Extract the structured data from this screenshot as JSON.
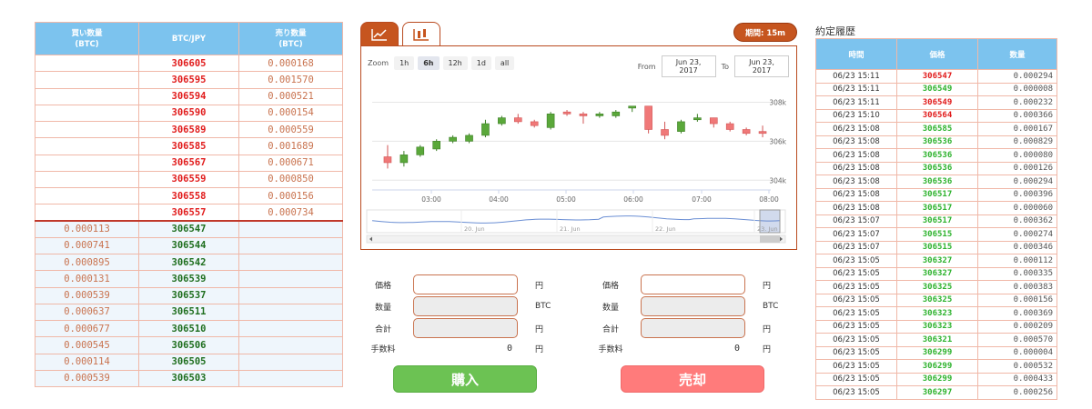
{
  "orderbook": {
    "headers": {
      "buy": "買い数量\n(BTC)",
      "price": "BTC/JPY",
      "sell": "売り数量\n(BTC)"
    },
    "asks": [
      {
        "price": "306605",
        "qty": "0.000168"
      },
      {
        "price": "306595",
        "qty": "0.001570"
      },
      {
        "price": "306594",
        "qty": "0.000521"
      },
      {
        "price": "306590",
        "qty": "0.000154"
      },
      {
        "price": "306589",
        "qty": "0.000559"
      },
      {
        "price": "306585",
        "qty": "0.001689"
      },
      {
        "price": "306567",
        "qty": "0.000671"
      },
      {
        "price": "306559",
        "qty": "0.000850"
      },
      {
        "price": "306558",
        "qty": "0.000156"
      },
      {
        "price": "306557",
        "qty": "0.000734"
      }
    ],
    "bids": [
      {
        "price": "306547",
        "qty": "0.000113"
      },
      {
        "price": "306544",
        "qty": "0.000741"
      },
      {
        "price": "306542",
        "qty": "0.000895"
      },
      {
        "price": "306539",
        "qty": "0.000131"
      },
      {
        "price": "306537",
        "qty": "0.000539"
      },
      {
        "price": "306511",
        "qty": "0.000637"
      },
      {
        "price": "306510",
        "qty": "0.000677"
      },
      {
        "price": "306506",
        "qty": "0.000545"
      },
      {
        "price": "306505",
        "qty": "0.000114"
      },
      {
        "price": "306503",
        "qty": "0.000539"
      }
    ]
  },
  "chart": {
    "tabs": [
      {
        "icon": "line-chart-icon",
        "active": true
      },
      {
        "icon": "candlestick-icon",
        "active": false
      }
    ],
    "period_badge": "期間: 15m",
    "zoom_label": "Zoom",
    "zoom_options": [
      "1h",
      "6h",
      "12h",
      "1d",
      "all"
    ],
    "zoom_selected": "6h",
    "from_label": "From",
    "from_date": "Jun 23, 2017",
    "to_label": "To",
    "to_date": "Jun 23, 2017",
    "y_ticks": [
      "308k",
      "306k",
      "304k"
    ],
    "x_ticks": [
      "03:00",
      "04:00",
      "05:00",
      "06:00",
      "07:00",
      "08:00"
    ],
    "navigator_ticks": [
      "20. Jun",
      "21. Jun",
      "22. Jun",
      "23. Jun"
    ]
  },
  "chart_data": {
    "type": "candlestick",
    "y_range": [
      303500,
      309000
    ],
    "candles": [
      {
        "o": 305200,
        "h": 305800,
        "l": 304600,
        "c": 304900
      },
      {
        "o": 304900,
        "h": 305500,
        "l": 304700,
        "c": 305300
      },
      {
        "o": 305300,
        "h": 305800,
        "l": 305200,
        "c": 305700
      },
      {
        "o": 305600,
        "h": 306100,
        "l": 305500,
        "c": 306000
      },
      {
        "o": 306000,
        "h": 306300,
        "l": 305900,
        "c": 306200
      },
      {
        "o": 306000,
        "h": 306400,
        "l": 305900,
        "c": 306300
      },
      {
        "o": 306300,
        "h": 307100,
        "l": 306200,
        "c": 306900
      },
      {
        "o": 306900,
        "h": 307300,
        "l": 306800,
        "c": 307200
      },
      {
        "o": 307200,
        "h": 307400,
        "l": 306900,
        "c": 307000
      },
      {
        "o": 307000,
        "h": 307100,
        "l": 306700,
        "c": 306800
      },
      {
        "o": 306700,
        "h": 307500,
        "l": 306600,
        "c": 307400
      },
      {
        "o": 307500,
        "h": 307600,
        "l": 307300,
        "c": 307400
      },
      {
        "o": 307400,
        "h": 307500,
        "l": 306900,
        "c": 307300
      },
      {
        "o": 307300,
        "h": 307500,
        "l": 307200,
        "c": 307400
      },
      {
        "o": 307300,
        "h": 307600,
        "l": 307200,
        "c": 307500
      },
      {
        "o": 307700,
        "h": 307800,
        "l": 307500,
        "c": 307800
      },
      {
        "o": 307800,
        "h": 307800,
        "l": 306400,
        "c": 306600
      },
      {
        "o": 306600,
        "h": 307000,
        "l": 306100,
        "c": 306300
      },
      {
        "o": 306500,
        "h": 307100,
        "l": 306400,
        "c": 307000
      },
      {
        "o": 307100,
        "h": 307400,
        "l": 307000,
        "c": 307200
      },
      {
        "o": 307200,
        "h": 307200,
        "l": 306700,
        "c": 306900
      },
      {
        "o": 306900,
        "h": 307000,
        "l": 306500,
        "c": 306600
      },
      {
        "o": 306600,
        "h": 306700,
        "l": 306300,
        "c": 306400
      },
      {
        "o": 306500,
        "h": 306800,
        "l": 306200,
        "c": 306400
      }
    ]
  },
  "buy_form": {
    "price_label": "価格",
    "price_unit": "円",
    "amount_label": "数量",
    "amount_unit": "BTC",
    "total_label": "合計",
    "total_unit": "円",
    "fee_label": "手数料",
    "fee_value": "0",
    "fee_unit": "円",
    "button": "購入"
  },
  "sell_form": {
    "price_label": "価格",
    "price_unit": "円",
    "amount_label": "数量",
    "amount_unit": "BTC",
    "total_label": "合計",
    "total_unit": "円",
    "fee_label": "手数料",
    "fee_value": "0",
    "fee_unit": "円",
    "button": "売却"
  },
  "trades": {
    "title": "約定履歴",
    "headers": {
      "time": "時間",
      "price": "価格",
      "amount": "数量"
    },
    "rows": [
      {
        "time": "06/23 15:11",
        "price": "306547",
        "amount": "0.000294",
        "dir": "down"
      },
      {
        "time": "06/23 15:11",
        "price": "306549",
        "amount": "0.000008",
        "dir": "up"
      },
      {
        "time": "06/23 15:11",
        "price": "306549",
        "amount": "0.000232",
        "dir": "down"
      },
      {
        "time": "06/23 15:10",
        "price": "306564",
        "amount": "0.000366",
        "dir": "down"
      },
      {
        "time": "06/23 15:08",
        "price": "306585",
        "amount": "0.000167",
        "dir": "up"
      },
      {
        "time": "06/23 15:08",
        "price": "306536",
        "amount": "0.000829",
        "dir": "up"
      },
      {
        "time": "06/23 15:08",
        "price": "306536",
        "amount": "0.000080",
        "dir": "up"
      },
      {
        "time": "06/23 15:08",
        "price": "306536",
        "amount": "0.000126",
        "dir": "up"
      },
      {
        "time": "06/23 15:08",
        "price": "306536",
        "amount": "0.000294",
        "dir": "up"
      },
      {
        "time": "06/23 15:08",
        "price": "306517",
        "amount": "0.000396",
        "dir": "up"
      },
      {
        "time": "06/23 15:08",
        "price": "306517",
        "amount": "0.000060",
        "dir": "up"
      },
      {
        "time": "06/23 15:07",
        "price": "306517",
        "amount": "0.000362",
        "dir": "up"
      },
      {
        "time": "06/23 15:07",
        "price": "306515",
        "amount": "0.000274",
        "dir": "up"
      },
      {
        "time": "06/23 15:07",
        "price": "306515",
        "amount": "0.000346",
        "dir": "up"
      },
      {
        "time": "06/23 15:05",
        "price": "306327",
        "amount": "0.000112",
        "dir": "up"
      },
      {
        "time": "06/23 15:05",
        "price": "306327",
        "amount": "0.000335",
        "dir": "up"
      },
      {
        "time": "06/23 15:05",
        "price": "306325",
        "amount": "0.000383",
        "dir": "up"
      },
      {
        "time": "06/23 15:05",
        "price": "306325",
        "amount": "0.000156",
        "dir": "up"
      },
      {
        "time": "06/23 15:05",
        "price": "306323",
        "amount": "0.000369",
        "dir": "up"
      },
      {
        "time": "06/23 15:05",
        "price": "306323",
        "amount": "0.000209",
        "dir": "up"
      },
      {
        "time": "06/23 15:05",
        "price": "306321",
        "amount": "0.000570",
        "dir": "up"
      },
      {
        "time": "06/23 15:05",
        "price": "306299",
        "amount": "0.000004",
        "dir": "up"
      },
      {
        "time": "06/23 15:05",
        "price": "306299",
        "amount": "0.000532",
        "dir": "up"
      },
      {
        "time": "06/23 15:05",
        "price": "306299",
        "amount": "0.000433",
        "dir": "up"
      },
      {
        "time": "06/23 15:05",
        "price": "306297",
        "amount": "0.000256",
        "dir": "up"
      }
    ]
  },
  "colors": {
    "accent": "#c6551f",
    "header_blue": "#7cc3ee",
    "ask_red": "#e11b1b",
    "bid_green": "#1e6e1e",
    "candle_up": "#5aa83a",
    "candle_down": "#f07878",
    "buy_button": "#6cc253",
    "sell_button": "#ff7b7b"
  }
}
